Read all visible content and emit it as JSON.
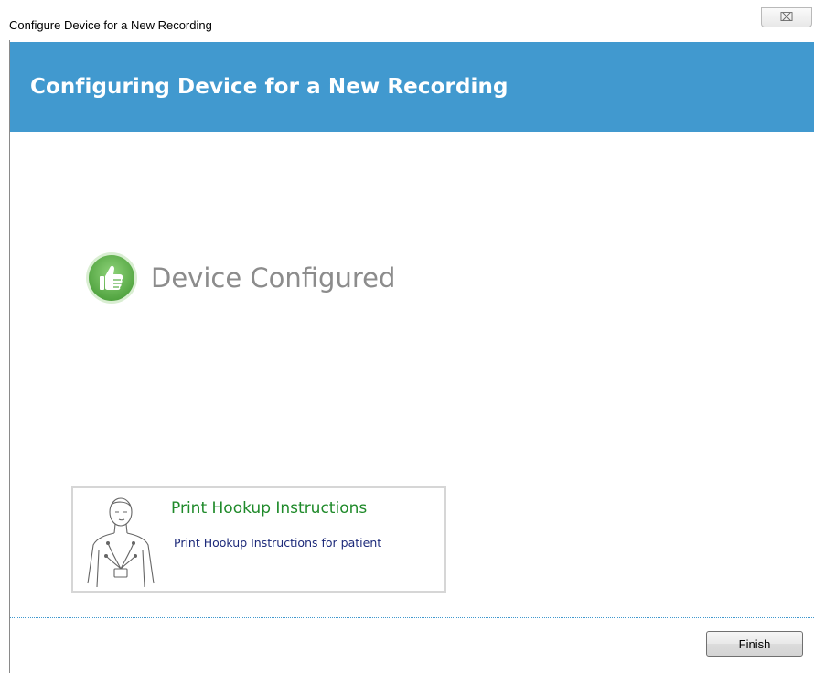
{
  "window": {
    "title": "Configure Device for a New Recording",
    "close_glyph": "⌧",
    "close_icon": "close-icon"
  },
  "header": {
    "title": "Configuring Device for a New Recording",
    "color": "#4199cf"
  },
  "status": {
    "icon": "thumbs-up-icon",
    "icon_color": "#5cb04a",
    "text": "Device Configured"
  },
  "hookup": {
    "icon": "patient-hookup-figure-icon",
    "title": "Print Hookup Instructions",
    "title_color": "#1f8a2a",
    "description": "Print Hookup Instructions for patient"
  },
  "footer": {
    "finish_label": "Finish"
  }
}
